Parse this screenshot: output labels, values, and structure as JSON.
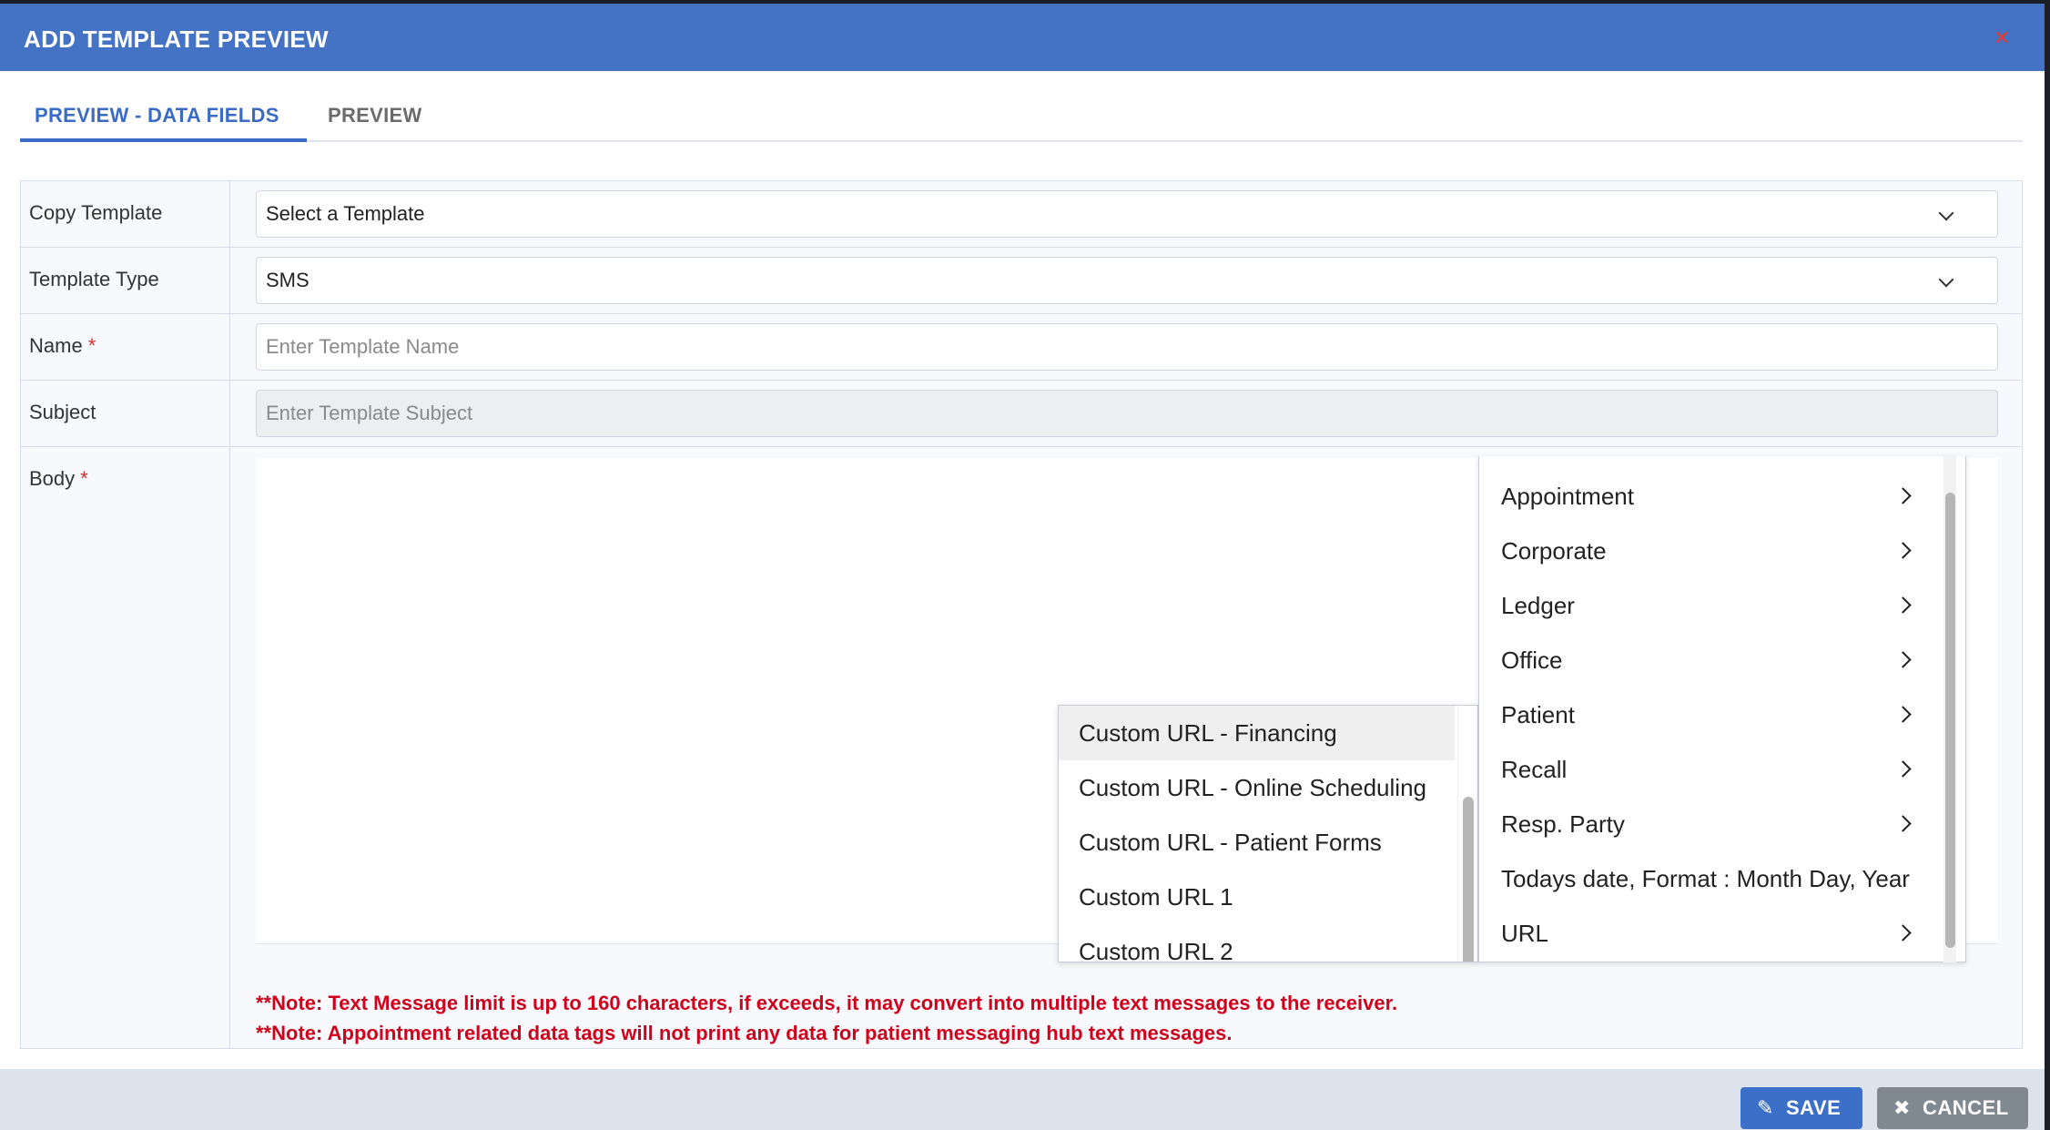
{
  "modal": {
    "title": "ADD TEMPLATE PREVIEW",
    "close_icon": "close-icon"
  },
  "tabs": [
    {
      "label": "PREVIEW - DATA FIELDS",
      "active": true
    },
    {
      "label": "PREVIEW",
      "active": false
    }
  ],
  "form": {
    "copy_template": {
      "label": "Copy Template",
      "value": "Select a Template"
    },
    "template_type": {
      "label": "Template Type",
      "value": "SMS"
    },
    "name": {
      "label": "Name",
      "required_mark": "*",
      "placeholder": "Enter Template Name"
    },
    "subject": {
      "label": "Subject",
      "placeholder": "Enter Template Subject"
    },
    "body": {
      "label": "Body",
      "required_mark": "*"
    }
  },
  "data_tag_menu": {
    "items": [
      {
        "label": "Appointment",
        "has_submenu": true
      },
      {
        "label": "Corporate",
        "has_submenu": true
      },
      {
        "label": "Ledger",
        "has_submenu": true
      },
      {
        "label": "Office",
        "has_submenu": true
      },
      {
        "label": "Patient",
        "has_submenu": true
      },
      {
        "label": "Recall",
        "has_submenu": true
      },
      {
        "label": "Resp. Party",
        "has_submenu": true
      },
      {
        "label": "Todays date, Format : Month Day, Year",
        "has_submenu": false
      },
      {
        "label": "URL",
        "has_submenu": true
      }
    ]
  },
  "url_submenu": {
    "items": [
      {
        "label": "Custom URL - Financing",
        "highlighted": true
      },
      {
        "label": "Custom URL - Online Scheduling"
      },
      {
        "label": "Custom URL - Patient Forms"
      },
      {
        "label": "Custom URL 1"
      },
      {
        "label": "Custom URL 2"
      }
    ]
  },
  "notes": [
    "**Note: Text Message limit is up to 160 characters, if exceeds, it may convert into multiple text messages to the receiver.",
    "**Note: Appointment related data tags will not print any data for patient messaging hub text messages."
  ],
  "footer": {
    "save_label": "SAVE",
    "cancel_label": "CANCEL",
    "save_icon": "pencil-icon",
    "cancel_icon": "x-icon"
  },
  "colors": {
    "header": "#4472c4",
    "accent": "#3a6bc6",
    "note_text": "#d0021b",
    "save_button": "#3c70c8",
    "cancel_button": "#808890"
  }
}
